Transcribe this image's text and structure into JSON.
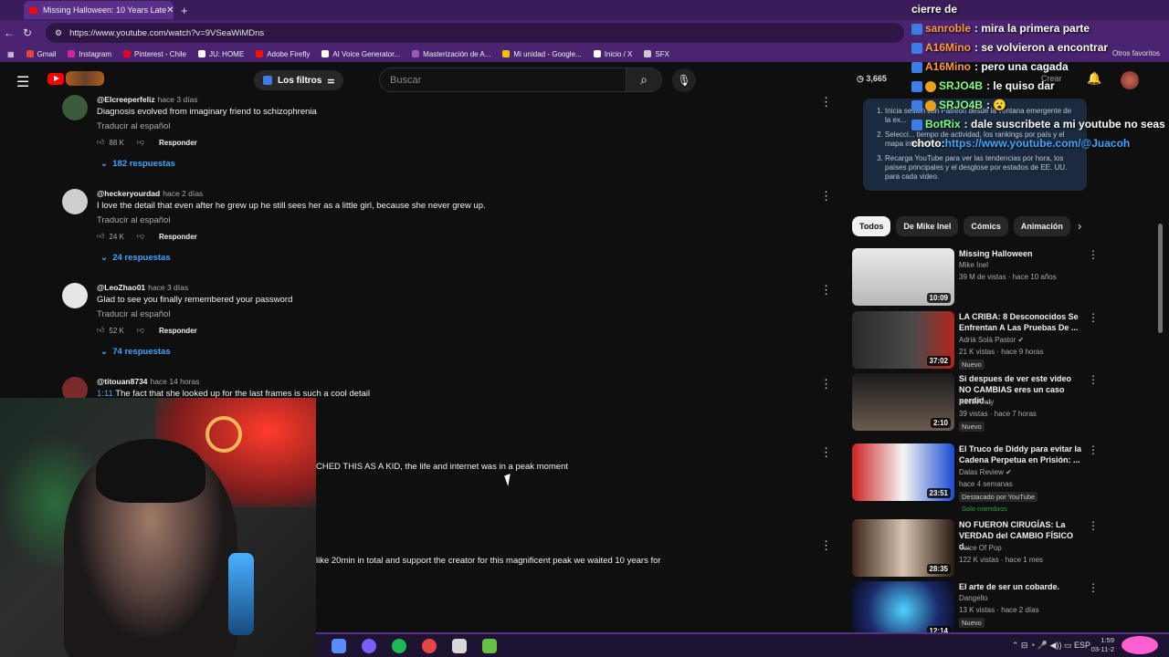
{
  "browser": {
    "tab_title": "Missing Halloween: 10 Years Late",
    "url": "https://www.youtube.com/watch?v=9VSeaWiMDns",
    "bookmarks": [
      {
        "label": "Gmail",
        "color": "#ea4335"
      },
      {
        "label": "Instagram",
        "color": "#d6249f"
      },
      {
        "label": "Pinterest - Chile",
        "color": "#e60023"
      },
      {
        "label": "JU: HOME",
        "color": "#ffffff"
      },
      {
        "label": "Adobe Firefly",
        "color": "#fa0f00"
      },
      {
        "label": "AI Voice Generator...",
        "color": "#ffffff"
      },
      {
        "label": "Masterización de A...",
        "color": "#9b59b6"
      },
      {
        "label": "Mi unidad - Google...",
        "color": "#fbbc04"
      },
      {
        "label": "Inicio / X",
        "color": "#ffffff"
      },
      {
        "label": "SFX",
        "color": "#cccccc"
      }
    ],
    "other_bookmarks": "Otros favoritos"
  },
  "header": {
    "filters_label": "Los filtros",
    "search_placeholder": "Buscar",
    "viewers": "3,665",
    "create_label": "Crear"
  },
  "comments": [
    {
      "author": "@Elcreeperfeliz",
      "time": "hace 3 días",
      "timestamp_link": "",
      "text": "Diagnosis evolved from imaginary friend to schizophrenia",
      "translate": "Traducir al español",
      "likes": "88 K",
      "reply": "Responder",
      "replies": "182 respuestas",
      "avatar_color": "#3a5a3a"
    },
    {
      "author": "@heckeryourdad",
      "time": "hace 2 días",
      "timestamp_link": "",
      "text": "I love the detail that even after he grew up he still sees her as a little girl, because she never grew up.",
      "translate": "Traducir al español",
      "likes": "24 K",
      "reply": "Responder",
      "replies": "24 respuestas",
      "avatar_color": "#cfcfcf"
    },
    {
      "author": "@LeoZhao01",
      "time": "hace 3 días",
      "timestamp_link": "",
      "text": "Glad to see you finally remembered your password",
      "translate": "Traducir al español",
      "likes": "52 K",
      "reply": "Responder",
      "replies": "74 respuestas",
      "avatar_color": "#e6e6e6"
    },
    {
      "author": "@titouan8734",
      "time": "hace 14 horas",
      "timestamp_link": "1:11",
      "text": "The fact that she looked up for the last frames is such a cool detail",
      "avatar_color": "#7a2a2a"
    }
  ],
  "orphan_texts": {
    "line1": "CHED THIS AS A KID, the life and internet was in a peak moment",
    "line2": "like 20min in total and support the creator for this magnificent peak we waited 10 years for"
  },
  "patreon_box": {
    "steps": [
      "Inicia sesión con Patreon desde la ventana emergente de la ex...",
      "Selecci... tiempo de actividad, los rankings por país y el mapa interactivo.",
      "Recarga YouTube para ver las tendencias por hora, los países principales y el desglose por estados de EE. UU. para cada video."
    ]
  },
  "chips": [
    "Todos",
    "De Mike Inel",
    "Cómics",
    "Animación"
  ],
  "videos": [
    {
      "title": "Missing Halloween",
      "channel": "Mike Inel",
      "meta": "39 M de vistas · hace 10 años",
      "duration": "10:09",
      "badge": "",
      "badge2": "",
      "verified": false,
      "thumb": "linear-gradient(#e9e9e9,#b8b8b8)"
    },
    {
      "title": "LA CRIBA: 8 Desconocidos Se Enfrentan A Las Pruebas De ...",
      "channel": "Adrià Solà Pastor",
      "meta": "21 K vistas · hace 9 horas",
      "duration": "37:02",
      "badge": "Nuevo",
      "badge2": "",
      "verified": true,
      "thumb": "linear-gradient(90deg,#2a2a2a,#4a4a4a 60%,#b3261e)"
    },
    {
      "title": "Si despues de ver este video NO CAMBIAS eres un caso perdid...",
      "channel": "KevinAndy",
      "meta": "39 vistas · hace 7 horas",
      "duration": "2:10",
      "badge": "Nuevo",
      "badge2": "",
      "verified": false,
      "thumb": "linear-gradient(#1a1a1a,#6b5a50)"
    },
    {
      "title": "El Truco de Diddy para evitar la Cadena Perpetua en Prisión: ...",
      "channel": "Dalas Review",
      "meta": "hace 4 semanas",
      "duration": "23:51",
      "badge": "Destacado por YouTube",
      "badge2": "Solo miembros",
      "verified": true,
      "thumb": "linear-gradient(90deg,#c22,#f5f5f5 50%,#1b4bd1)"
    },
    {
      "title": "NO FUERON CIRUGÍAS: La VERDAD del CAMBIO FÍSICO d...",
      "channel": "Voice Of Pop",
      "meta": "122 K vistas · hace 1 mes",
      "duration": "28:35",
      "badge": "",
      "badge2": "",
      "verified": false,
      "thumb": "linear-gradient(90deg,#3a2418,#d8c4b0 50%,#2a1a12)"
    },
    {
      "title": "El arte de ser un cobarde.",
      "channel": "Dangello",
      "meta": "13 K vistas · hace 2 días",
      "duration": "12:14",
      "badge": "Nuevo",
      "badge2": "",
      "verified": false,
      "thumb": "radial-gradient(circle,#4fd2ff,#1a2a6a 60%,#0a0a1a)"
    }
  ],
  "chat": [
    {
      "user": "",
      "msg": "cierre de",
      "color": "#ffffff",
      "badge": "none"
    },
    {
      "user": "sanroble",
      "msg": ": mira la primera parte",
      "color": "#ff9a3c",
      "badge": "sub"
    },
    {
      "user": "A16Mino",
      "msg": ": se volvieron a encontrar",
      "color": "#ff9a3c",
      "badge": "sub"
    },
    {
      "user": "A16Mino",
      "msg": ": pero una cagada",
      "color": "#ff9a3c",
      "badge": "sub"
    },
    {
      "user": "SRJO4B",
      "msg": ": le quiso dar",
      "color": "#7fff7f",
      "badge": "gift"
    },
    {
      "user": "SRJO4B",
      "msg": ": 😮",
      "color": "#7fff7f",
      "badge": "gift"
    },
    {
      "user": "BotRix",
      "msg": ": dale suscribete a mi youtube no seas",
      "color": "#7fff7f",
      "badge": "sub"
    },
    {
      "user": "",
      "msg": "choto: ",
      "color": "#ffffff",
      "badge": "none",
      "link": "https://www.youtube.com/@Juacoh"
    }
  ],
  "taskbar": {
    "tray": "ESP",
    "time": "1:59",
    "date": "03-11-2"
  }
}
